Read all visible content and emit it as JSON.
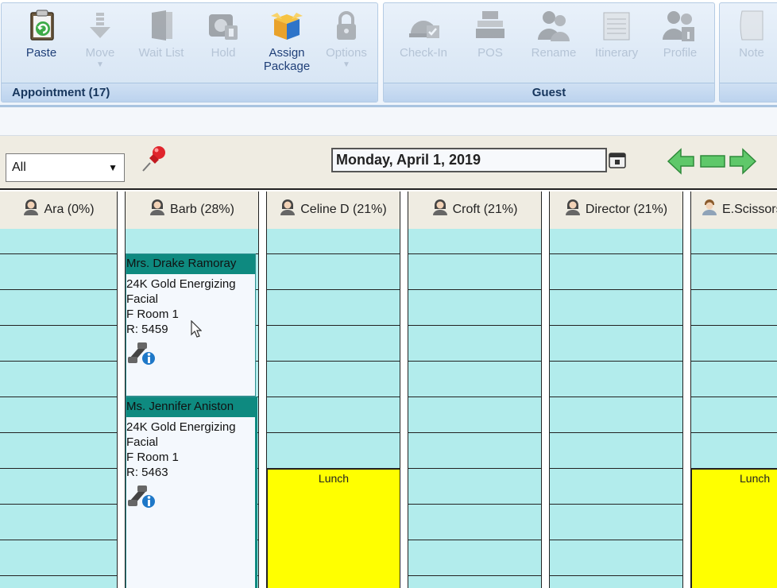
{
  "ribbon": {
    "appointment_group": {
      "label": "Appointment (17)",
      "buttons": [
        {
          "label": "Paste",
          "icon": "paste-icon",
          "enabled": true
        },
        {
          "label": "Move",
          "icon": "move-icon",
          "enabled": false
        },
        {
          "label": "Wait List",
          "icon": "wait-list-icon",
          "enabled": false
        },
        {
          "label": "Hold",
          "icon": "hold-icon",
          "enabled": false
        },
        {
          "label": "Assign",
          "label2": "Package",
          "icon": "package-icon",
          "enabled": true
        },
        {
          "label": "Options",
          "icon": "lock-icon",
          "enabled": false
        }
      ]
    },
    "guest_group": {
      "label": "Guest",
      "buttons": [
        {
          "label": "Check-In",
          "icon": "bell-icon",
          "enabled": false
        },
        {
          "label": "POS",
          "icon": "pos-icon",
          "enabled": false
        },
        {
          "label": "Rename",
          "icon": "rename-icon",
          "enabled": false
        },
        {
          "label": "Itinerary",
          "icon": "itinerary-icon",
          "enabled": false
        },
        {
          "label": "Profile",
          "icon": "profile-icon",
          "enabled": false
        }
      ]
    },
    "note_group": {
      "buttons": [
        {
          "label": "Note",
          "icon": "note-icon",
          "enabled": false
        }
      ]
    }
  },
  "toolbar": {
    "filter_value": "All",
    "date": "Monday, April 1, 2019"
  },
  "schedule": {
    "columns": [
      {
        "name": "Ara (0%)",
        "icon": "female-person-icon"
      },
      {
        "name": "Barb (28%)",
        "icon": "female-person-icon"
      },
      {
        "name": "Celine D (21%)",
        "icon": "female-person-icon"
      },
      {
        "name": "Croft (21%)",
        "icon": "female-person-icon"
      },
      {
        "name": "Director (21%)",
        "icon": "female-person-icon"
      },
      {
        "name": "E.Scissors",
        "icon": "male-person-icon"
      }
    ],
    "appointments": [
      {
        "guest": "Mrs. Drake Ramoray",
        "service_line1": "24K Gold Energizing",
        "service_line2": "Facial",
        "room": "F Room 1",
        "reservation": "R: 5459"
      },
      {
        "guest": "Ms. Jennifer Aniston",
        "service_line1": "24K Gold Energizing",
        "service_line2": "Facial",
        "room": "F Room 1",
        "reservation": "R: 5463"
      }
    ],
    "lunch_label": "Lunch"
  },
  "colors": {
    "slot": "#b2ecec",
    "appointment_header": "#0e8a80",
    "lunch": "#ffff00",
    "ribbon_label": "#17365d"
  }
}
